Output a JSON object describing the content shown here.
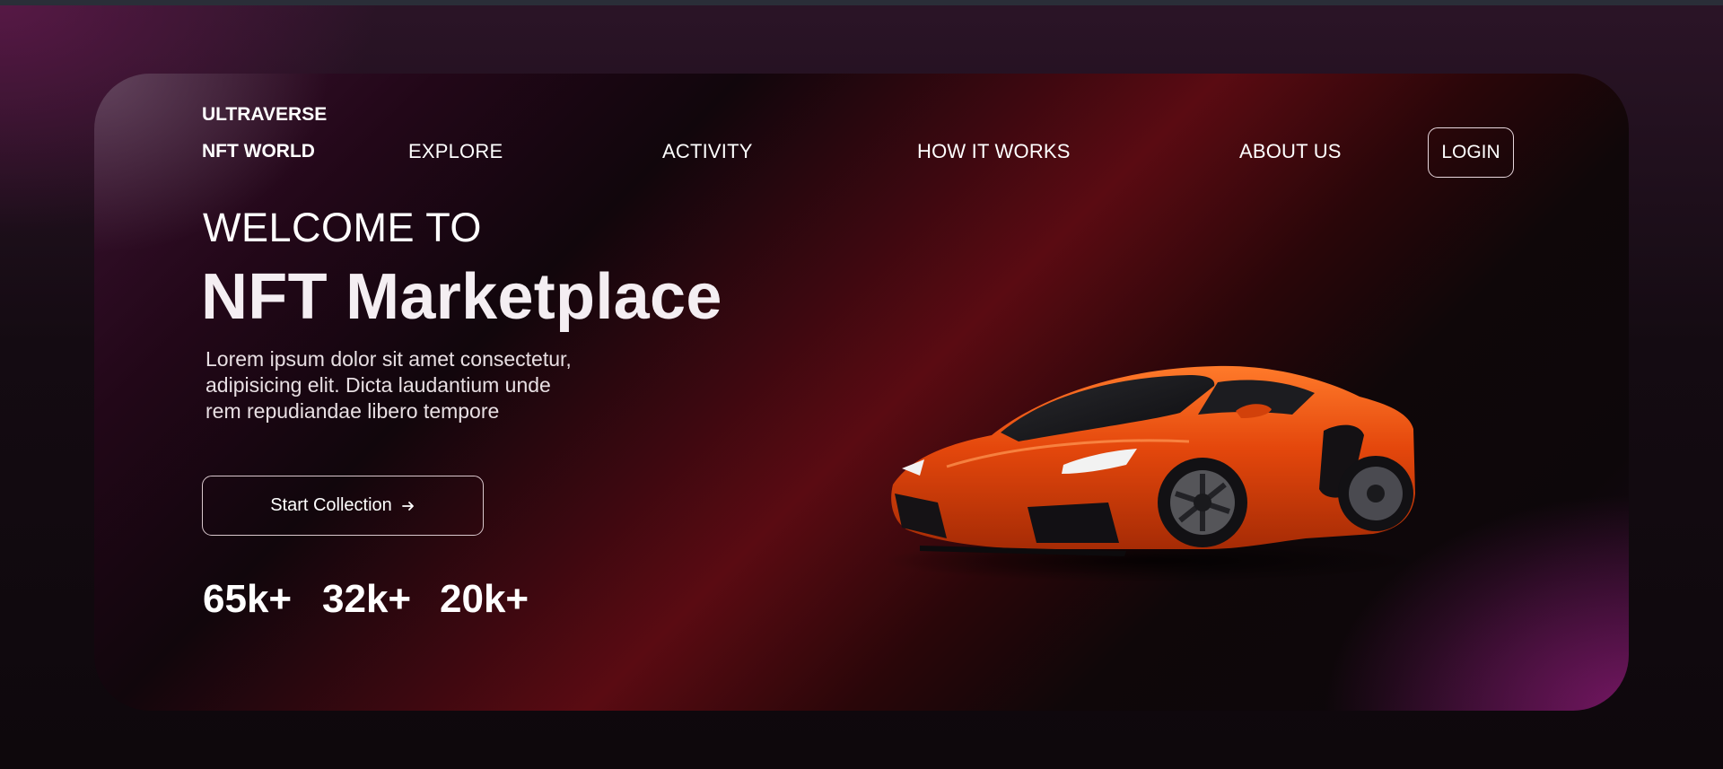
{
  "brand": {
    "line1": "ULTRAVERSE",
    "line2": "NFT WORLD"
  },
  "nav": {
    "explore": "EXPLORE",
    "activity": "ACTIVITY",
    "how_it_works": "HOW IT WORKS",
    "about_us": "ABOUT US",
    "login": "LOGIN"
  },
  "hero": {
    "welcome": "WELCOME TO",
    "headline": "NFT Marketplace",
    "description": "Lorem ipsum dolor sit amet consectetur, adipisicing elit. Dicta laudantium unde rem repudiandae libero tempore",
    "cta_label": "Start Collection",
    "cta_icon": "arrow-right-icon",
    "image": "orange-sports-car"
  },
  "stats": [
    "65k+",
    "32k+",
    "20k+"
  ],
  "colors": {
    "page_background": "#0f080d",
    "card_deep_red": "#5a0b12",
    "card_purple": "#3a1230",
    "car_orange": "#e24a0c",
    "text": "#ffffff"
  }
}
